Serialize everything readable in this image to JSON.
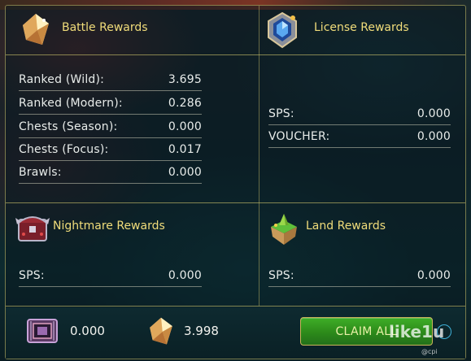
{
  "battle": {
    "title": "Battle Rewards",
    "rows": [
      {
        "label": "Ranked (Wild):",
        "value": "3.695"
      },
      {
        "label": "Ranked (Modern):",
        "value": "0.286"
      },
      {
        "label": "Chests (Season):",
        "value": "0.000"
      },
      {
        "label": "Chests (Focus):",
        "value": "0.017"
      },
      {
        "label": "Brawls:",
        "value": "0.000"
      }
    ]
  },
  "license": {
    "title": "License Rewards",
    "rows": [
      {
        "label": "SPS:",
        "value": "0.000"
      },
      {
        "label": "VOUCHER:",
        "value": "0.000"
      }
    ]
  },
  "nightmare": {
    "title": "Nightmare Rewards",
    "rows": [
      {
        "label": "SPS:",
        "value": "0.000"
      }
    ]
  },
  "land": {
    "title": "Land Rewards",
    "rows": [
      {
        "label": "SPS:",
        "value": "0.000"
      }
    ]
  },
  "footer": {
    "chip_value": "0.000",
    "crystal_value": "3.998",
    "claim_label": "CLAIM ALL",
    "watermark": "like1u",
    "watermark_sub": "@cpi"
  },
  "colors": {
    "accent_gold": "#f0dc7a",
    "button_green": "#2c8a1a",
    "help_blue": "#3fb0d8"
  },
  "icons": {
    "battle": "crystal-shard-icon",
    "license": "gem-badge-icon",
    "nightmare": "nightmare-chest-icon",
    "land": "floating-island-icon",
    "chip": "chip-icon",
    "crystal": "crystal-shard-icon",
    "help": "help-icon"
  }
}
